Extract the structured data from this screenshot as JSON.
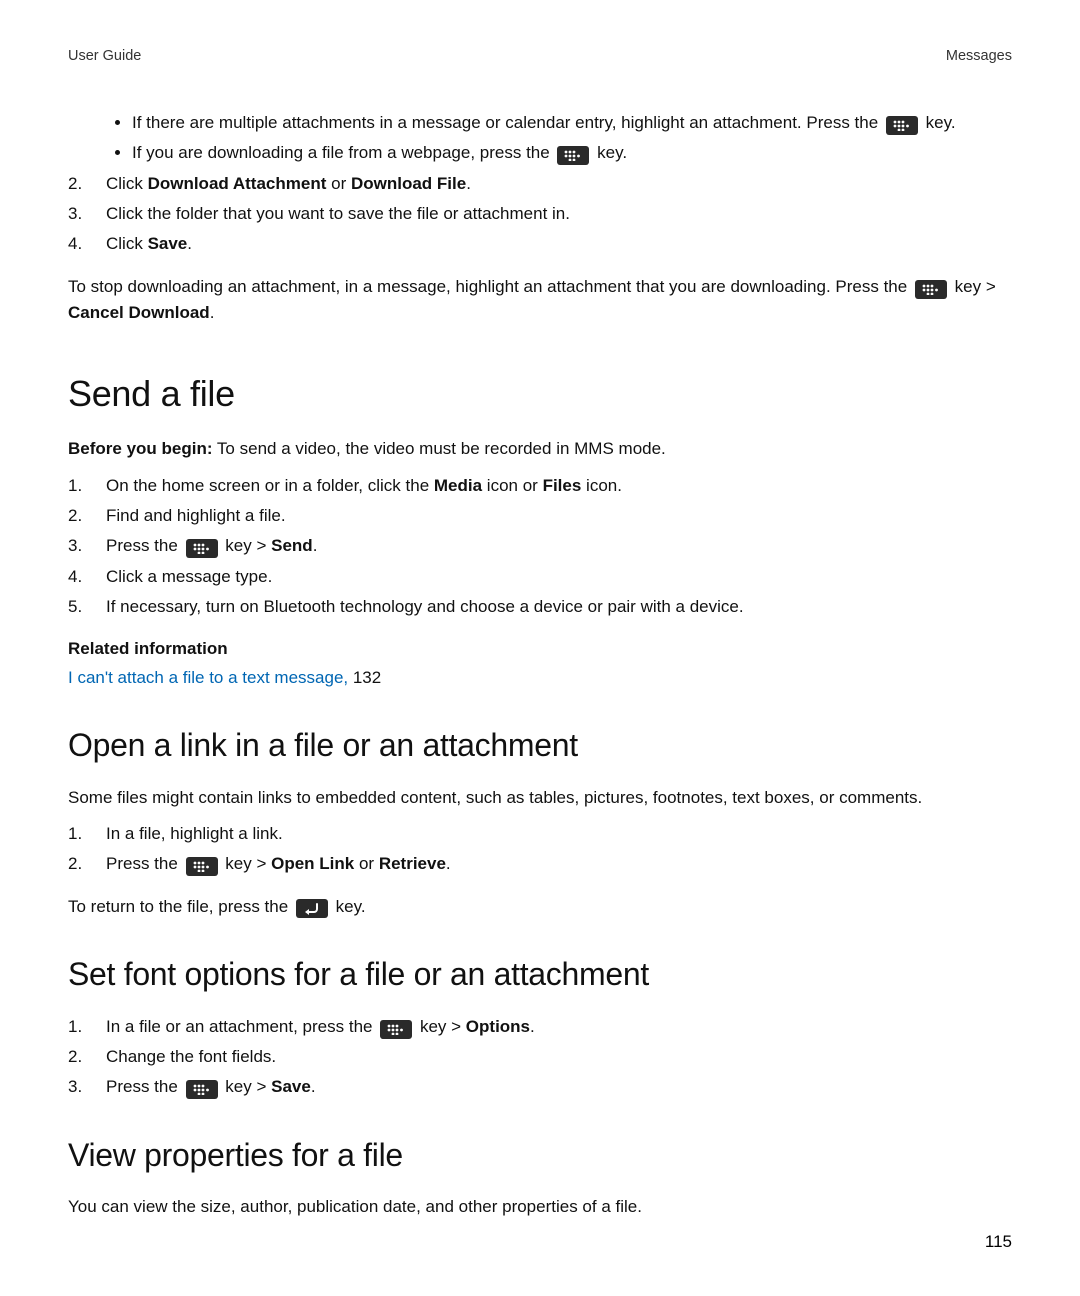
{
  "header": {
    "left": "User Guide",
    "right": "Messages"
  },
  "page_number": "115",
  "intro_bullets": {
    "b1_a": "If there are multiple attachments in a message or calendar entry, highlight an attachment. Press the",
    "b1_b": "key.",
    "b2_a": "If you are downloading a file from a webpage, press the",
    "b2_b": "key."
  },
  "intro_steps": {
    "n2": "2.",
    "s2_a": "Click ",
    "s2_b1": "Download Attachment",
    "s2_or": " or ",
    "s2_b2": "Download File",
    "s2_c": ".",
    "n3": "3.",
    "s3": "Click the folder that you want to save the file or attachment in.",
    "n4": "4.",
    "s4_a": "Click ",
    "s4_b": "Save",
    "s4_c": "."
  },
  "intro_stop": {
    "a": "To stop downloading an attachment, in a message, highlight an attachment that you are downloading. Press the",
    "b": "key > ",
    "c": "Cancel Download",
    "d": "."
  },
  "send": {
    "title": "Send a file",
    "before_label": "Before you begin:",
    "before_text": " To send a video, the video must be recorded in MMS mode.",
    "n1": "1.",
    "s1_a": "On the home screen or in a folder, click the ",
    "s1_b1": "Media",
    "s1_mid": " icon or ",
    "s1_b2": "Files",
    "s1_c": " icon.",
    "n2": "2.",
    "s2": "Find and highlight a file.",
    "n3": "3.",
    "s3_a": "Press the",
    "s3_b": "key > ",
    "s3_c": "Send",
    "s3_d": ".",
    "n4": "4.",
    "s4": "Click a message type.",
    "n5": "5.",
    "s5": "If necessary, turn on Bluetooth technology and choose a device or pair with a device."
  },
  "related": {
    "header": "Related information",
    "link_text": "I can't attach a file to a text message,",
    "page_ref": " 132"
  },
  "openlink": {
    "title": "Open a link in a file or an attachment",
    "intro": "Some files might contain links to embedded content, such as tables, pictures, footnotes, text boxes, or comments.",
    "n1": "1.",
    "s1": "In a file, highlight a link.",
    "n2": "2.",
    "s2_a": "Press the",
    "s2_b": "key > ",
    "s2_c1": "Open Link",
    "s2_or": " or ",
    "s2_c2": "Retrieve",
    "s2_d": ".",
    "ret_a": "To return to the file, press the",
    "ret_b": "key."
  },
  "font": {
    "title": "Set font options for a file or an attachment",
    "n1": "1.",
    "s1_a": "In a file or an attachment, press the",
    "s1_b": "key > ",
    "s1_c": "Options",
    "s1_d": ".",
    "n2": "2.",
    "s2": "Change the font fields.",
    "n3": "3.",
    "s3_a": "Press the",
    "s3_b": "key > ",
    "s3_c": "Save",
    "s3_d": "."
  },
  "props": {
    "title": "View properties for a file",
    "intro": "You can view the size, author, publication date, and other properties of a file."
  }
}
